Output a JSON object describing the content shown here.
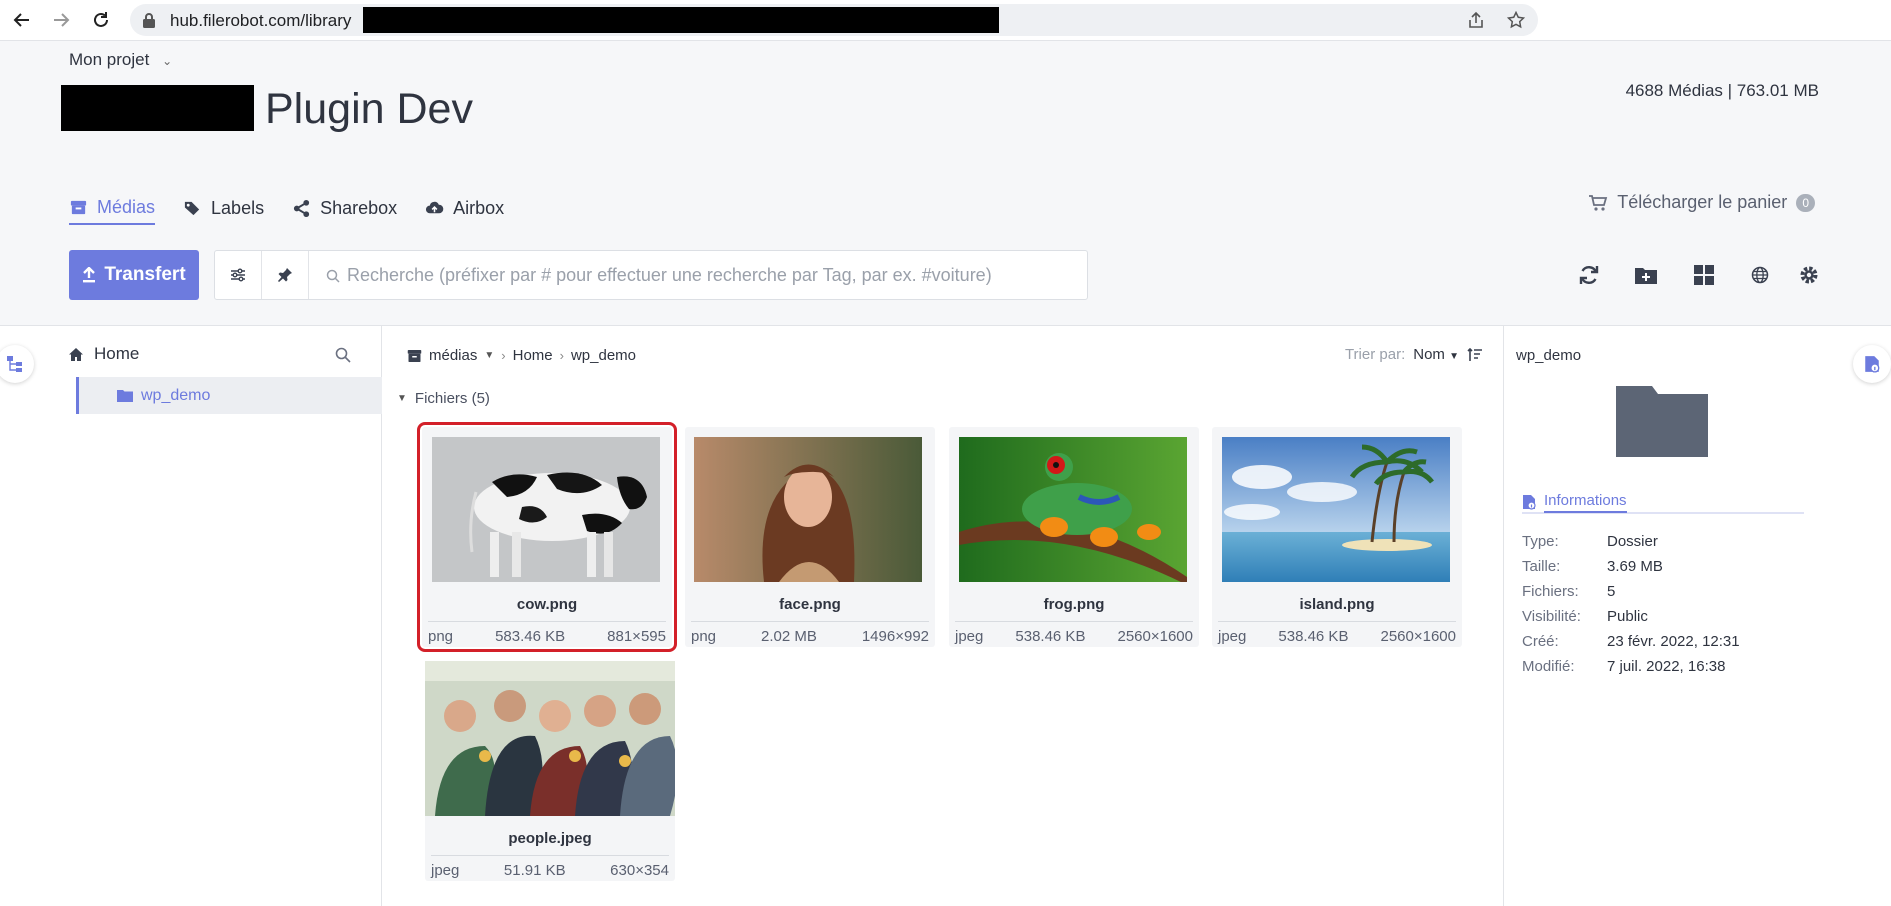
{
  "browser": {
    "url": "hub.filerobot.com/library"
  },
  "header": {
    "project_label": "Mon projet",
    "title": "Plugin Dev",
    "stats": "4688 Médias | 763.01 MB"
  },
  "tabs": [
    {
      "label": "Médias",
      "active": true
    },
    {
      "label": "Labels",
      "active": false
    },
    {
      "label": "Sharebox",
      "active": false
    },
    {
      "label": "Airbox",
      "active": false
    }
  ],
  "cart": {
    "label": "Télécharger le panier",
    "count": "0"
  },
  "toolbar": {
    "transfer_label": "Transfert",
    "search_placeholder": "Recherche (préfixer par # pour effectuer une recherche par Tag, par ex. #voiture)"
  },
  "tree": {
    "root": "Home",
    "selected": "wp_demo"
  },
  "breadcrumb": {
    "root": "médias",
    "items": [
      "Home",
      "wp_demo"
    ]
  },
  "sort": {
    "label": "Trier par:",
    "value": "Nom"
  },
  "section": {
    "label": "Fichiers (5)"
  },
  "files": [
    {
      "name": "cow.png",
      "type": "png",
      "size": "583.46 KB",
      "dims": "881×595",
      "selected": true
    },
    {
      "name": "face.png",
      "type": "png",
      "size": "2.02 MB",
      "dims": "1496×992",
      "selected": false
    },
    {
      "name": "frog.png",
      "type": "jpeg",
      "size": "538.46 KB",
      "dims": "2560×1600",
      "selected": false
    },
    {
      "name": "island.png",
      "type": "jpeg",
      "size": "538.46 KB",
      "dims": "2560×1600",
      "selected": false
    },
    {
      "name": "people.jpeg",
      "type": "jpeg",
      "size": "51.91 KB",
      "dims": "630×354",
      "selected": false
    }
  ],
  "details": {
    "name": "wp_demo",
    "tab_label": "Informations",
    "rows": [
      {
        "key": "Type:",
        "value": "Dossier"
      },
      {
        "key": "Taille:",
        "value": "3.69 MB"
      },
      {
        "key": "Fichiers:",
        "value": "5"
      },
      {
        "key": "Visibilité:",
        "value": "Public"
      },
      {
        "key": "Créé:",
        "value": "23 févr. 2022, 12:31"
      },
      {
        "key": "Modifié:",
        "value": "7 juil. 2022, 16:38"
      }
    ]
  },
  "colors": {
    "accent": "#6d7bde",
    "selection": "#d32029",
    "folder": "#5c6575"
  }
}
